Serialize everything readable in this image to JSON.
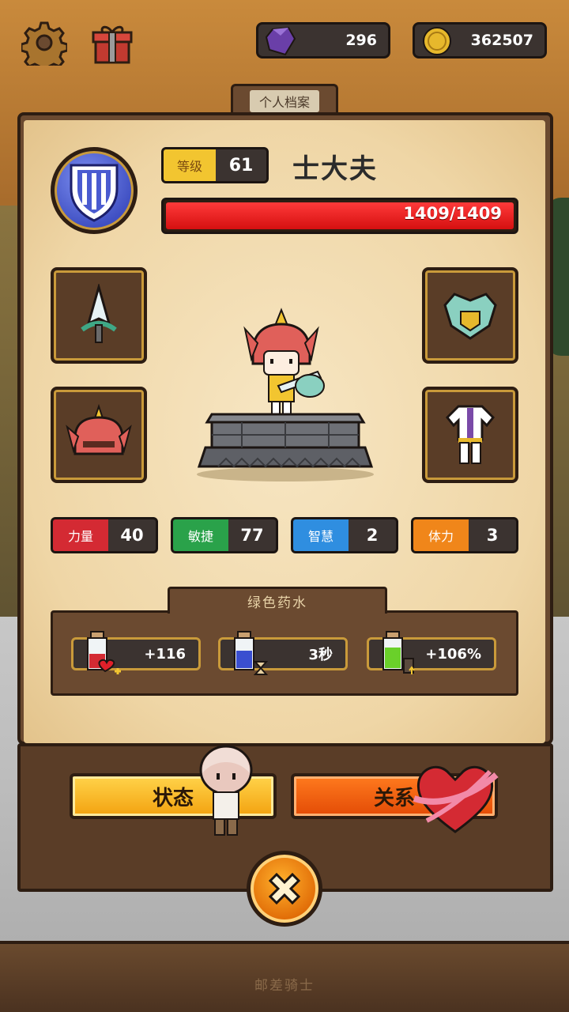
{
  "top_bar": {
    "settings_icon": "gear-icon",
    "gift_icon": "gift-box-icon",
    "gems": {
      "icon": "purple-gem-icon",
      "value": "296"
    },
    "gold": {
      "icon": "gold-coin-icon",
      "value": "362507"
    }
  },
  "tab_title": "个人档案",
  "profile": {
    "emblem_icon": "shield-emblem-icon",
    "level_label": "等级",
    "level_value": "61",
    "name": "士大夫",
    "hp_text": "1409/1409",
    "hp_fraction": 1.0
  },
  "equipment": {
    "weapon_icon": "spear-weapon-icon",
    "shield_icon": "shield-armor-icon",
    "helmet_icon": "helmet-icon",
    "armor_icon": "body-armor-icon",
    "character_icon": "knight-character-icon",
    "pedestal_icon": "stone-pedestal-icon"
  },
  "stats": [
    {
      "label": "力量",
      "value": "40",
      "color": "#d42a33"
    },
    {
      "label": "敏捷",
      "value": "77",
      "color": "#2aa24a"
    },
    {
      "label": "智慧",
      "value": "2",
      "color": "#2f8ee0"
    },
    {
      "label": "体力",
      "value": "3",
      "color": "#f0861a"
    }
  ],
  "potion_section": {
    "title": "绿色药水",
    "items": [
      {
        "icon": "red-potion-heart-icon",
        "value": "+116"
      },
      {
        "icon": "blue-potion-hourglass-icon",
        "value": "3秒"
      },
      {
        "icon": "green-potion-boost-icon",
        "value": "+106%"
      }
    ]
  },
  "buttons": {
    "status": "状态",
    "relation": "关系",
    "close_icon": "close-icon"
  },
  "footer": "邮差骑士"
}
